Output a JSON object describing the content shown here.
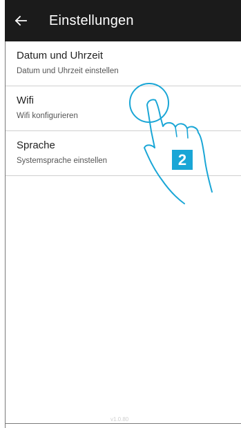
{
  "appbar": {
    "back_icon": "arrow-left-icon",
    "title": "Einstellungen"
  },
  "settings": {
    "items": [
      {
        "title": "Datum und Uhrzeit",
        "subtitle": "Datum und Uhrzeit einstellen"
      },
      {
        "title": "Wifi",
        "subtitle": "Wifi konfigurieren"
      },
      {
        "title": "Sprache",
        "subtitle": "Systemsprache einstellen"
      }
    ]
  },
  "footer": {
    "version": "v1.0.80"
  },
  "annotation": {
    "step_number": "2",
    "step_color": "#1aa6d6",
    "gesture_icon": "tap-hand-icon"
  },
  "colors": {
    "appbar_bg": "#1b1b1b",
    "divider": "#cfcfcf"
  }
}
